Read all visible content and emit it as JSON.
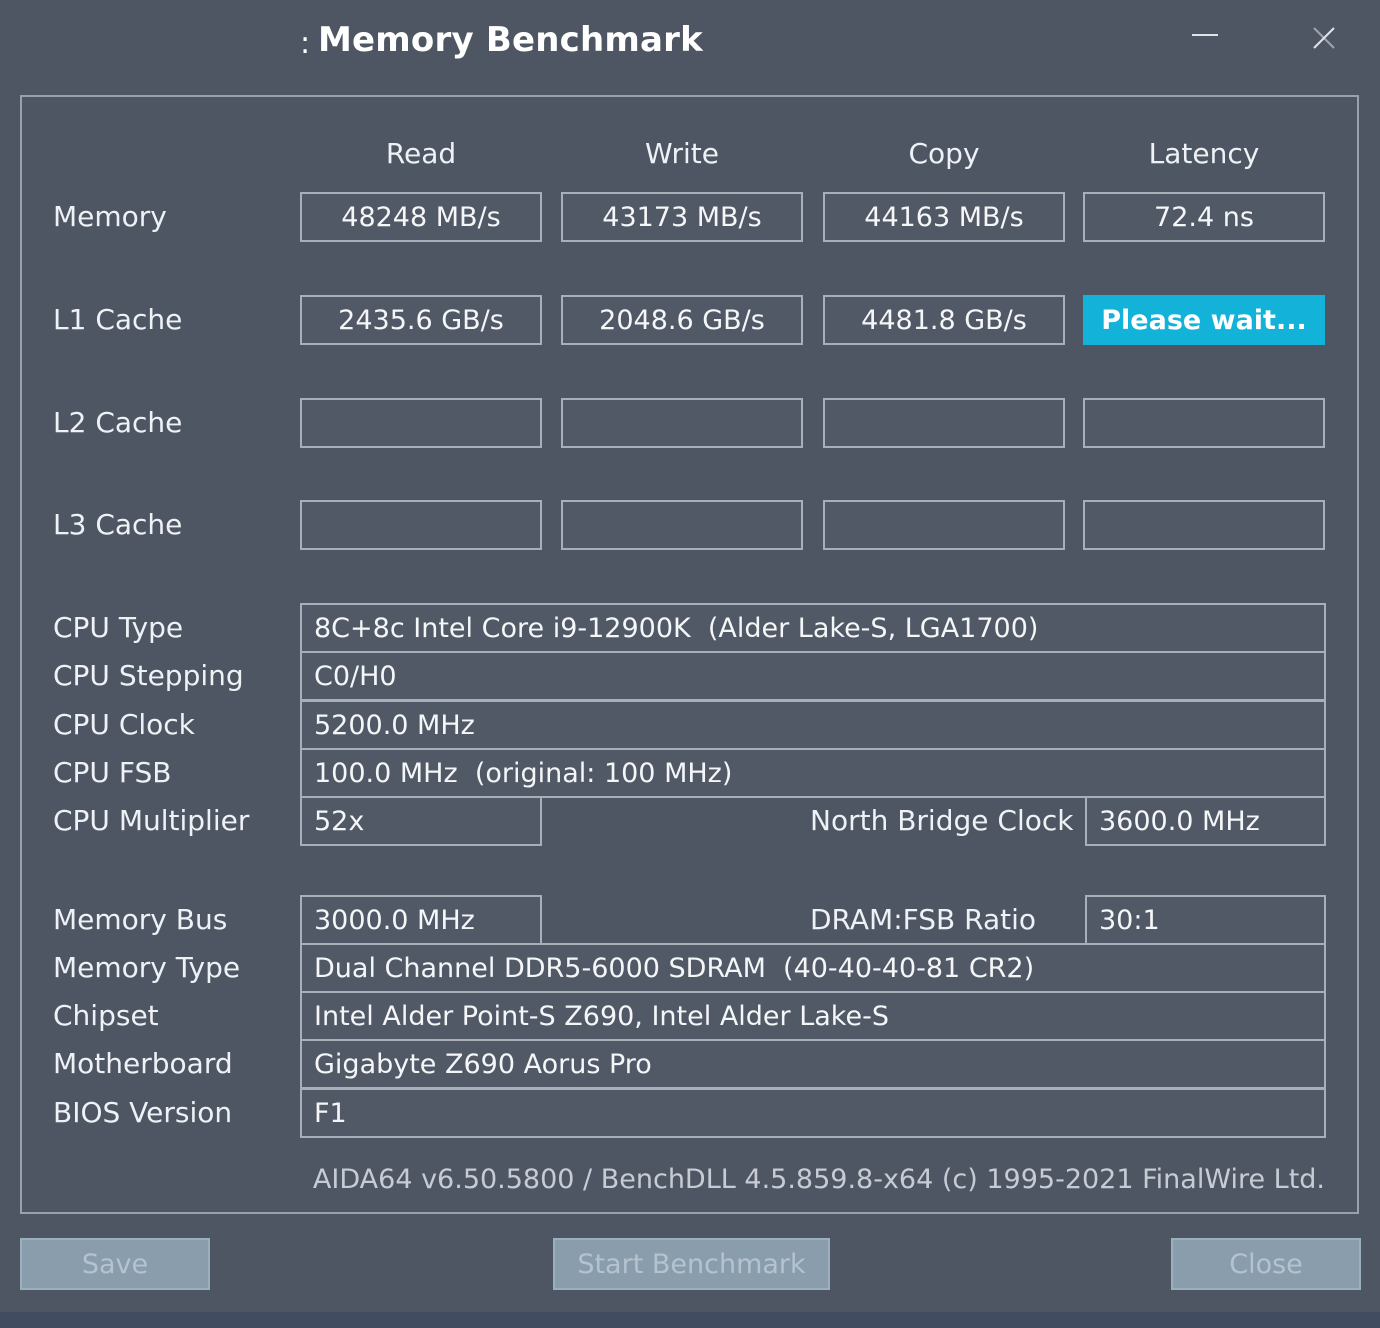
{
  "window": {
    "title": "Memory Benchmark",
    "title_prefix": ":",
    "minimize_icon": "minimize-icon",
    "close_icon": "close-icon"
  },
  "columns": [
    "Read",
    "Write",
    "Copy",
    "Latency"
  ],
  "bench": {
    "memory": {
      "label": "Memory",
      "read": "48248 MB/s",
      "write": "43173 MB/s",
      "copy": "44163 MB/s",
      "latency": "72.4 ns"
    },
    "l1": {
      "label": "L1 Cache",
      "read": "2435.6 GB/s",
      "write": "2048.6 GB/s",
      "copy": "4481.8 GB/s",
      "latency": "Please wait..."
    },
    "l2": {
      "label": "L2 Cache",
      "read": "",
      "write": "",
      "copy": "",
      "latency": ""
    },
    "l3": {
      "label": "L3 Cache",
      "read": "",
      "write": "",
      "copy": "",
      "latency": ""
    }
  },
  "info": {
    "cpu_type": {
      "label": "CPU Type",
      "value": "8C+8c Intel Core i9-12900K  (Alder Lake-S, LGA1700)"
    },
    "cpu_stepping": {
      "label": "CPU Stepping",
      "value": "C0/H0"
    },
    "cpu_clock": {
      "label": "CPU Clock",
      "value": "5200.0 MHz"
    },
    "cpu_fsb": {
      "label": "CPU FSB",
      "value": "100.0 MHz  (original: 100 MHz)"
    },
    "cpu_multiplier": {
      "label": "CPU Multiplier",
      "value": "52x"
    },
    "nb_clock": {
      "label": "North Bridge Clock",
      "value": "3600.0 MHz"
    },
    "memory_bus": {
      "label": "Memory Bus",
      "value": "3000.0 MHz"
    },
    "dram_fsb": {
      "label": "DRAM:FSB Ratio",
      "value": "30:1"
    },
    "memory_type": {
      "label": "Memory Type",
      "value": "Dual Channel DDR5-6000 SDRAM  (40-40-40-81 CR2)"
    },
    "chipset": {
      "label": "Chipset",
      "value": "Intel Alder Point-S Z690, Intel Alder Lake-S"
    },
    "motherboard": {
      "label": "Motherboard",
      "value": "Gigabyte Z690 Aorus Pro"
    },
    "bios": {
      "label": "BIOS Version",
      "value": "F1"
    }
  },
  "footer": "AIDA64 v6.50.5800 / BenchDLL 4.5.859.8-x64  (c) 1995-2021 FinalWire Ltd.",
  "buttons": {
    "save": "Save",
    "start": "Start Benchmark",
    "close": "Close"
  },
  "colors": {
    "background": "#4f5663",
    "accent_wait": "#12b2d9",
    "button_disabled": "#8a9dac"
  }
}
